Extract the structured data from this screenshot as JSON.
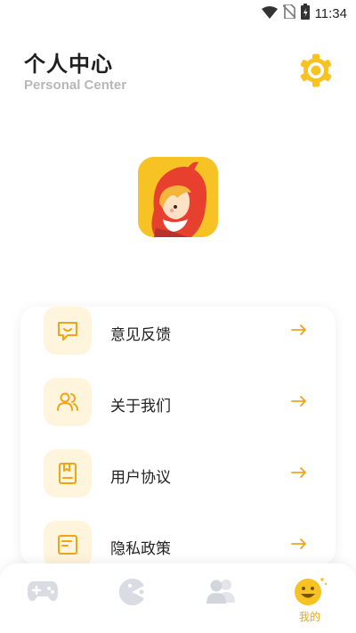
{
  "status_bar": {
    "time": "11:34"
  },
  "header": {
    "title": "个人中心",
    "subtitle": "Personal Center"
  },
  "menu": [
    {
      "label": "意见反馈",
      "icon": "feedback-icon"
    },
    {
      "label": "关于我们",
      "icon": "users-icon"
    },
    {
      "label": "用户协议",
      "icon": "document-icon"
    },
    {
      "label": "隐私政策",
      "icon": "privacy-icon"
    }
  ],
  "tabbar": {
    "tabs": [
      {
        "icon": "gamepad-icon",
        "label": ""
      },
      {
        "icon": "pacman-icon",
        "label": ""
      },
      {
        "icon": "people-icon",
        "label": ""
      },
      {
        "icon": "smile-icon",
        "label": "我的",
        "active": true
      }
    ]
  },
  "colors": {
    "accent": "#f7c324",
    "icon_bg": "#fff4dc",
    "tab_inactive": "#d9dce3",
    "subtitle": "#b7b7b7"
  }
}
